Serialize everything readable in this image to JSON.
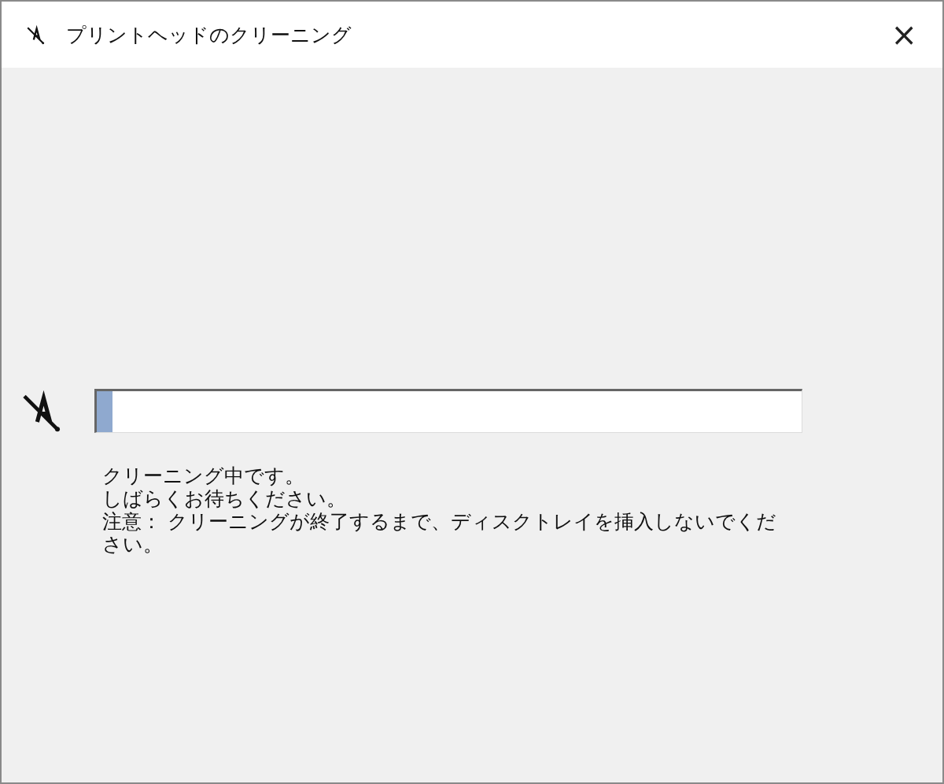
{
  "window": {
    "title": "プリントヘッドのクリーニング",
    "close": "×"
  },
  "progress": {
    "level": 0.022
  },
  "message": [
    "クリーニング中です。",
    "しばらくお待ちください。",
    "注意： クリーニングが終了するまで、ディスクトレイを挿入しないでください。"
  ]
}
